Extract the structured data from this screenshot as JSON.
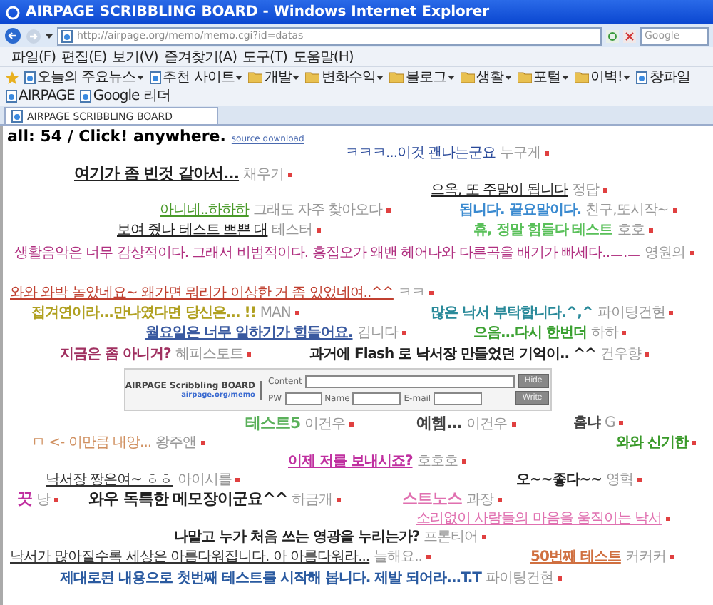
{
  "window": {
    "title": "AIRPAGE SCRIBBLING BOARD - Windows Internet Explorer"
  },
  "address_bar": {
    "url": "http://airpage.org/memo/memo.cgi?id=datas",
    "search_placeholder": "Google"
  },
  "menu": [
    "파일(F)",
    "편집(E)",
    "보기(V)",
    "즐겨찾기(A)",
    "도구(T)",
    "도움말(H)"
  ],
  "favorites": [
    {
      "label": "오늘의 주요뉴스",
      "kind": "page",
      "dropdown": true
    },
    {
      "label": "추천 사이트",
      "kind": "page",
      "dropdown": true
    },
    {
      "label": "개발",
      "kind": "folder",
      "dropdown": true
    },
    {
      "label": "변화수익",
      "kind": "folder",
      "dropdown": true
    },
    {
      "label": "블로그",
      "kind": "folder",
      "dropdown": true
    },
    {
      "label": "생활",
      "kind": "folder",
      "dropdown": true
    },
    {
      "label": "포털",
      "kind": "folder",
      "dropdown": true
    },
    {
      "label": "이벽!",
      "kind": "folder",
      "dropdown": true
    },
    {
      "label": "창파일",
      "kind": "page",
      "dropdown": false
    },
    {
      "label": "AIRPAGE",
      "kind": "page",
      "dropdown": false
    },
    {
      "label": "Google 리더",
      "kind": "page",
      "dropdown": false
    }
  ],
  "tab": {
    "label": "AIRPAGE SCRIBBLING BOARD",
    "selected": true
  },
  "header": {
    "count": "all: 54 / Click! anywhere.",
    "link": "source download"
  },
  "memos": [
    {
      "text": "ㅋㅋㅋ...이것 괜나는군요",
      "author": "누구게",
      "color": "#2a4a9a",
      "kind": "small",
      "underlined": false
    },
    {
      "text": "여기가 좀 빈것 같아서...",
      "author": "채우기",
      "color": "#222222",
      "kind": "big",
      "underlined": true
    },
    {
      "text": "으옥, 또 주말이 됩니다",
      "author": "정답",
      "color": "#222222",
      "kind": "small",
      "underlined": true
    },
    {
      "text": "아니네..하하하",
      "author": "그래도 자주 찾아오다",
      "color": "#4a9a2a",
      "kind": "small",
      "underlined": true
    },
    {
      "text": "됩니다. 끝요말이다.",
      "author": "친구,또시작~",
      "color": "#3a8ad0",
      "kind": "normal",
      "underlined": false
    },
    {
      "text": "보여 줬나 테스트 쁘쁜 대",
      "author": "테스터",
      "color": "#222222",
      "kind": "small",
      "underlined": true
    },
    {
      "text": "휴, 정말 힘들다 테스트",
      "author": "호호",
      "color": "#5ac05a",
      "kind": "normal",
      "underlined": false
    },
    {
      "text": "생활음악은 너무 감상적이다. 그래서 비범적이다. 흥집오가 왜밴 헤어나와 다른곡을 배기가 빠세다..ㅡ.ㅡ",
      "author": "영원의",
      "color": "#b03080",
      "kind": "small",
      "underlined": false
    },
    {
      "text": "와와 와박 놀았네요~ 왜가면 뭐리가 이상한 거 좀 있었네여..^^",
      "author": "ㅋㅋ",
      "color": "#c04030",
      "kind": "small",
      "underlined": true
    },
    {
      "text": "접겨연이라...만나였다면 당신은... !!",
      "author": "MAN",
      "color": "#b0a020",
      "kind": "normal",
      "underlined": false
    },
    {
      "text": "많은 낙서 부탁합니다.^,^",
      "author": "파이팅건현",
      "color": "#2a8a9a",
      "kind": "normal",
      "underlined": false
    },
    {
      "text": "월요일은 너무 일하기가 힘들어요.",
      "author": "김니다",
      "color": "#3a5aa0",
      "kind": "normal",
      "underlined": true
    },
    {
      "text": "으음...다시 한번더",
      "author": "하하",
      "color": "#3aa030",
      "kind": "normal",
      "underlined": false
    },
    {
      "text": "지금은 좀 아니거?",
      "author": "혜피스토트",
      "color": "#a03060",
      "kind": "normal",
      "underlined": false
    },
    {
      "text": "과거에 Flash 로 낙서장 만들었던 기억이.. ^^",
      "author": "건우향",
      "color": "#222222",
      "kind": "normal",
      "underlined": false
    },
    {
      "text": "테스트5",
      "author": "이건우",
      "color": "#5ab05a",
      "kind": "big",
      "underlined": false
    },
    {
      "text": "예헴...",
      "author": "이건우",
      "color": "#444444",
      "kind": "big",
      "underlined": false
    },
    {
      "text": "홈냐",
      "author": "G",
      "color": "#444444",
      "kind": "normal",
      "underlined": false
    },
    {
      "text": "ㅁ <- 이만큼 내앙...",
      "author": "왕주앤",
      "color": "#d09060",
      "kind": "small",
      "underlined": false
    },
    {
      "text": "와와 신기한",
      "color": "#3a9a2a",
      "kind": "normal",
      "underlined": false
    },
    {
      "text": "이제 저를 보내시죠?",
      "author": "호호호",
      "color": "#c030a0",
      "kind": "normal",
      "underlined": true
    },
    {
      "text": "낙서장 짱은여~ ㅎㅎ",
      "author": "아이시를",
      "color": "#333333",
      "kind": "small",
      "underlined": true
    },
    {
      "text": "오~~좋다~~",
      "author": "영혁",
      "color": "#222222",
      "kind": "normal",
      "underlined": false
    },
    {
      "text": "끗",
      "author": "낭",
      "color": "#c030a0",
      "kind": "big",
      "underlined": false
    },
    {
      "text": "와우 독특한 메모장이군요^^",
      "author": "하금개",
      "color": "#222222",
      "kind": "big",
      "underlined": false
    },
    {
      "text": "스트노스",
      "author": "과장",
      "color": "#e070b0",
      "kind": "big",
      "underlined": false
    },
    {
      "text": "소리없이 사람들의 마음을 움직이는 낙서",
      "color": "#e070b0",
      "kind": "small",
      "underlined": true
    },
    {
      "text": "나말고 누가 처음 쓰는 영광을 누리는가?",
      "author": "프론티어",
      "color": "#222222",
      "kind": "normal",
      "underlined": false
    },
    {
      "text": "낙서가 많아질수록 세상은 아름다워집니다. 아 아름다워라...",
      "author": "늘해요..",
      "color": "#333333",
      "kind": "small",
      "underlined": true
    },
    {
      "text": "50번째 테스트",
      "author": "커커커",
      "color": "#d07040",
      "kind": "normal",
      "underlined": true
    },
    {
      "text": "제대로된 내용으로 첫번째 테스트를 시작해 봅니다. 제발 되어라...T.T",
      "author": "파이팅건현",
      "color": "#2a5aa0",
      "kind": "normal",
      "underlined": false
    }
  ],
  "form": {
    "logo": "AIRPAGE Scribbling BOARD",
    "site": "airpage.org/memo",
    "content_label": "Content",
    "pw_label": "PW",
    "name_label": "Name",
    "email_label": "E-mail",
    "hide_button": "Hide",
    "write_button": "Write"
  }
}
